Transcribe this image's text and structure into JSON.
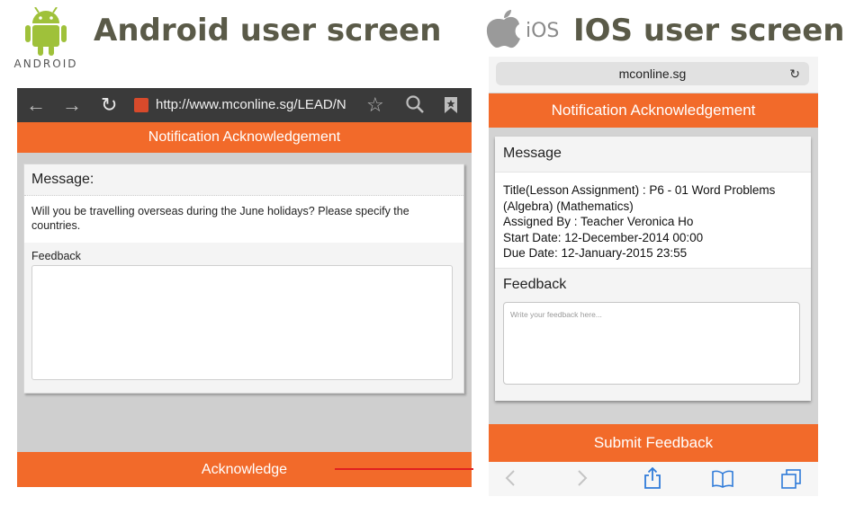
{
  "headers": {
    "android_wordmark": "ANDROID",
    "android_title": "Android user screen",
    "ios_logo_text": "iOS",
    "ios_title": "IOS user screen"
  },
  "android": {
    "url": "http://www.mconline.sg/LEAD/N",
    "header_title": "Notification Acknowledgement",
    "message_label": "Message:",
    "message_text": "Will you be travelling overseas during the June holidays? Please specify the countries.",
    "feedback_label": "Feedback",
    "feedback_value": "",
    "acknowledge_label": "Acknowledge"
  },
  "ios": {
    "url": "mconline.sg",
    "header_title": "Notification Acknowledgement",
    "message_label": "Message",
    "message_lines": [
      "Title(Lesson Assignment) : P6 - 01 Word Problems (Algebra) (Mathematics)",
      "Assigned By : Teacher Veronica Ho",
      "Start Date: 12-December-2014 00:00",
      "Due Date: 12-January-2015 23:55"
    ],
    "feedback_label": "Feedback",
    "feedback_placeholder": "Write your feedback here...",
    "submit_label": "Submit Feedback"
  },
  "colors": {
    "accent": "#f26a2a",
    "android_green": "#9fc13a",
    "highlight_line": "#e02020"
  },
  "icons": {
    "android_toolbar": [
      "back-arrow-icon",
      "forward-arrow-icon",
      "reload-icon",
      "favicon-icon",
      "star-icon",
      "search-icon",
      "bookmark-icon"
    ],
    "ios_toolbar": [
      "back-chevron-icon",
      "forward-chevron-icon",
      "share-icon",
      "bookmarks-book-icon",
      "tabs-icon"
    ]
  }
}
